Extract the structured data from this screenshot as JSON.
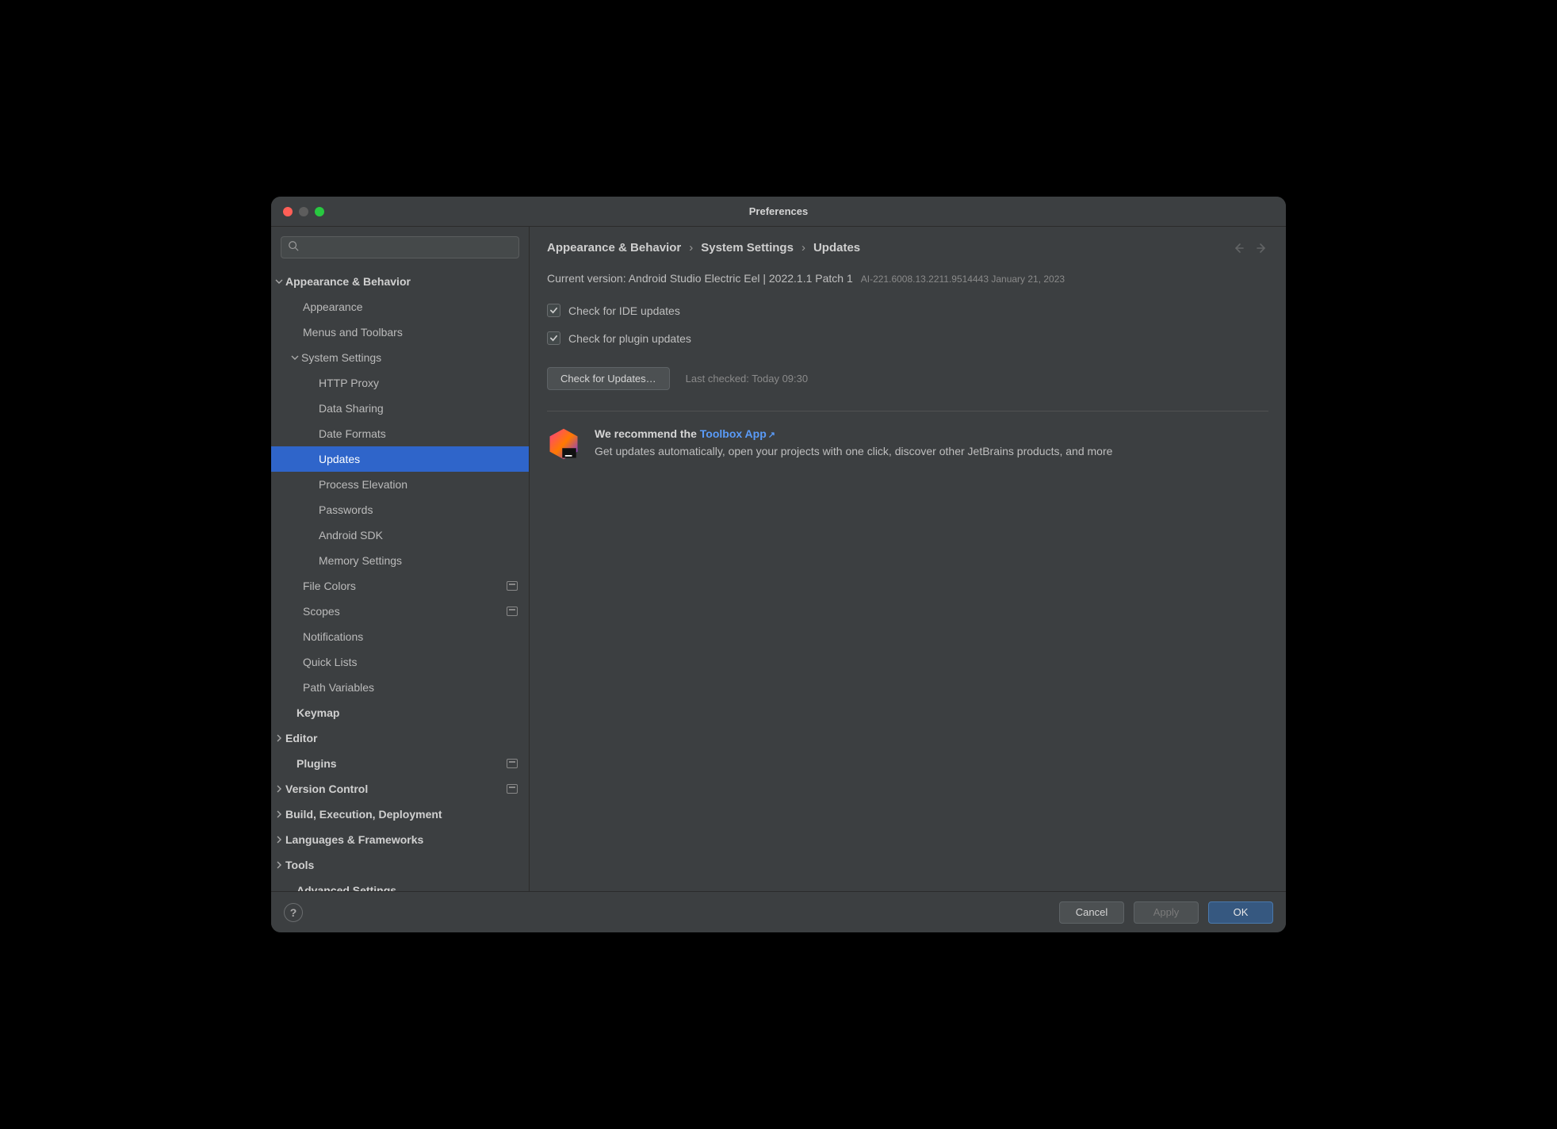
{
  "window": {
    "title": "Preferences"
  },
  "search": {
    "placeholder": ""
  },
  "sidebar": {
    "items": [
      {
        "label": "Appearance & Behavior",
        "level": 0,
        "bold": true,
        "expanded": true
      },
      {
        "label": "Appearance",
        "level": 1
      },
      {
        "label": "Menus and Toolbars",
        "level": 1
      },
      {
        "label": "System Settings",
        "level": 1,
        "expanded": true
      },
      {
        "label": "HTTP Proxy",
        "level": 2
      },
      {
        "label": "Data Sharing",
        "level": 2
      },
      {
        "label": "Date Formats",
        "level": 2
      },
      {
        "label": "Updates",
        "level": 2,
        "selected": true
      },
      {
        "label": "Process Elevation",
        "level": 2
      },
      {
        "label": "Passwords",
        "level": 2
      },
      {
        "label": "Android SDK",
        "level": 2
      },
      {
        "label": "Memory Settings",
        "level": 2
      },
      {
        "label": "File Colors",
        "level": 1,
        "badge": true
      },
      {
        "label": "Scopes",
        "level": 1,
        "badge": true
      },
      {
        "label": "Notifications",
        "level": 1
      },
      {
        "label": "Quick Lists",
        "level": 1
      },
      {
        "label": "Path Variables",
        "level": 1
      },
      {
        "label": "Keymap",
        "level": 0,
        "bold": true
      },
      {
        "label": "Editor",
        "level": 0,
        "bold": true,
        "collapsed": true
      },
      {
        "label": "Plugins",
        "level": 0,
        "bold": true,
        "badge": true
      },
      {
        "label": "Version Control",
        "level": 0,
        "bold": true,
        "collapsed": true,
        "badge": true
      },
      {
        "label": "Build, Execution, Deployment",
        "level": 0,
        "bold": true,
        "collapsed": true
      },
      {
        "label": "Languages & Frameworks",
        "level": 0,
        "bold": true,
        "collapsed": true
      },
      {
        "label": "Tools",
        "level": 0,
        "bold": true,
        "collapsed": true
      },
      {
        "label": "Advanced Settings",
        "level": 0,
        "bold": true
      }
    ]
  },
  "breadcrumb": {
    "part1": "Appearance & Behavior",
    "part2": "System Settings",
    "part3": "Updates",
    "sep": "›"
  },
  "version": {
    "label": "Current version: Android Studio Electric Eel | 2022.1.1 Patch 1",
    "build": "AI-221.6008.13.2211.9514443 January 21, 2023"
  },
  "checks": {
    "ide": "Check for IDE updates",
    "plugins": "Check for plugin updates"
  },
  "update": {
    "button": "Check for Updates…",
    "last_checked": "Last checked: Today 09:30"
  },
  "recommend": {
    "prefix": "We recommend the ",
    "link": "Toolbox App",
    "description": "Get updates automatically, open your projects with one click, discover other JetBrains products, and more"
  },
  "footer": {
    "help": "?",
    "cancel": "Cancel",
    "apply": "Apply",
    "ok": "OK"
  }
}
